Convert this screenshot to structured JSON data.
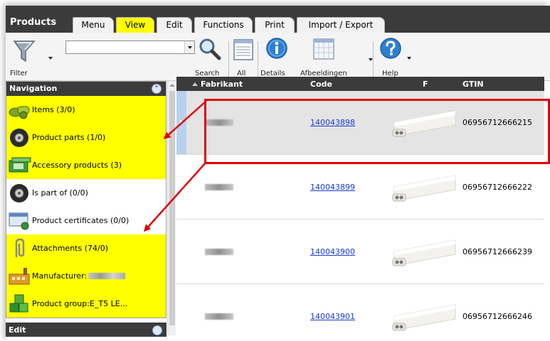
{
  "app_title": "Products",
  "tabs": [
    {
      "label": "Menu",
      "active": false
    },
    {
      "label": "View",
      "active": true
    },
    {
      "label": "Edit",
      "active": false
    },
    {
      "label": "Functions",
      "active": false
    },
    {
      "label": "Print",
      "active": false
    },
    {
      "label": "Import / Export",
      "active": false
    }
  ],
  "toolbar": {
    "filter_label": "Filter",
    "filter_value": "",
    "search_label": "Search",
    "all_label": "All",
    "details_label": "Details",
    "afbeeldingen_label": "Afbeeldingen",
    "help_label": "Help"
  },
  "navigation": {
    "title": "Navigation",
    "items": [
      {
        "label": "Items (3/0)",
        "highlighted": true,
        "icon": "items-icon"
      },
      {
        "label": "Product parts (1/0)",
        "highlighted": true,
        "icon": "tire-icon"
      },
      {
        "label": "Accessory products (3)",
        "highlighted": true,
        "icon": "accessory-box-icon"
      },
      {
        "label": "Is part of (0/0)",
        "highlighted": false,
        "icon": "tire-icon"
      },
      {
        "label": "Product certificates (0/0)",
        "highlighted": false,
        "icon": "certificate-icon"
      },
      {
        "label": "Attachments (74/0)",
        "highlighted": true,
        "icon": "paperclip-icon"
      },
      {
        "label": "Manufacturer:",
        "highlighted": true,
        "icon": "factory-icon"
      },
      {
        "label": "Product group:E_T5 LE...",
        "highlighted": true,
        "icon": "cubes-icon"
      }
    ]
  },
  "edit_panel_title": "Edit",
  "grid": {
    "columns": [
      "Fabrikant",
      "Code",
      "F",
      "GTIN"
    ],
    "rows": [
      {
        "code": "140043898",
        "gtin": "06956712666215",
        "selected": true
      },
      {
        "code": "140043899",
        "gtin": "06956712666222",
        "selected": false
      },
      {
        "code": "140043900",
        "gtin": "06956712666239",
        "selected": false
      },
      {
        "code": "140043901",
        "gtin": "06956712666246",
        "selected": false
      }
    ]
  },
  "colors": {
    "header_dark": "#3b3b3b",
    "highlight_yellow": "#ffff00",
    "annotation_red": "#e00000",
    "link_blue": "#1a3bd6"
  }
}
